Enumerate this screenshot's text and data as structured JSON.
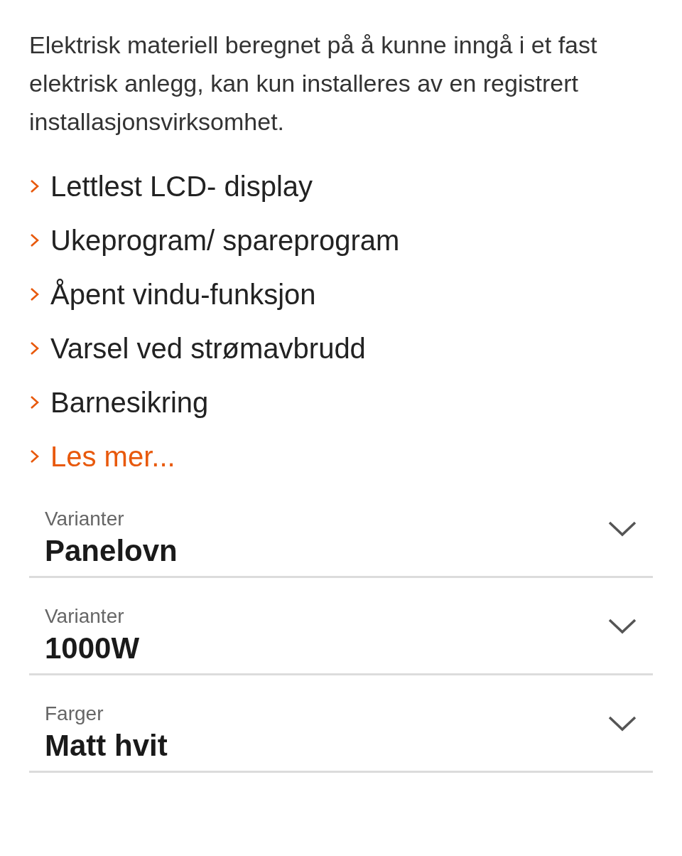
{
  "description": "Elektrisk materiell beregnet på å kunne inngå i et fast elektrisk anlegg, kan kun installeres av en registrert installasjonsvirksomhet.",
  "features": [
    {
      "text": "Lettlest LCD- display"
    },
    {
      "text": "Ukeprogram/ spareprogram"
    },
    {
      "text": "Åpent vindu-funksjon"
    },
    {
      "text": "Varsel ved strømavbrudd"
    },
    {
      "text": "Barnesikring"
    }
  ],
  "more_link": "Les mer...",
  "selects": [
    {
      "label": "Varianter",
      "value": "Panelovn"
    },
    {
      "label": "Varianter",
      "value": "1000W"
    },
    {
      "label": "Farger",
      "value": "Matt hvit"
    }
  ]
}
